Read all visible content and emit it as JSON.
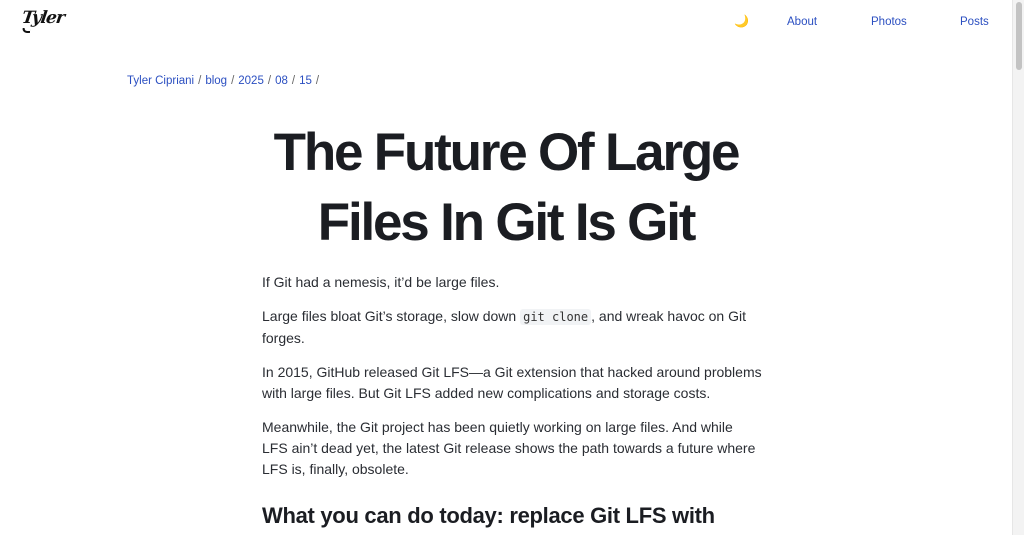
{
  "header": {
    "logo_text": "Tyler",
    "theme_toggle_glyph": "🌙",
    "nav": [
      {
        "label": "About"
      },
      {
        "label": "Photos"
      },
      {
        "label": "Posts"
      }
    ]
  },
  "breadcrumb": {
    "items": [
      "Tyler Cipriani",
      "blog",
      "2025",
      "08",
      "15"
    ],
    "separator": "/"
  },
  "post": {
    "title_line1": "The Future Of Large",
    "title_line2": "Files In Git Is Git",
    "p1": "If Git had a nemesis, it’d be large files.",
    "p2_before": "Large files bloat Git’s storage, slow down ",
    "p2_code": "git clone",
    "p2_after": ", and wreak havoc on Git forges.",
    "p3": "In 2015, GitHub released Git LFS—a Git extension that hacked around problems with large files. But Git LFS added new complications and storage costs.",
    "p4": "Meanwhile, the Git project has been quietly working on large files. And while LFS ain’t dead yet, the latest Git release shows the path towards a future where LFS is, finally, obsolete.",
    "h2": "What you can do today: replace Git LFS with"
  },
  "colors": {
    "link": "#2b4fc1",
    "text": "#2a2d33",
    "heading": "#1b1d22",
    "background": "#ffffff"
  }
}
